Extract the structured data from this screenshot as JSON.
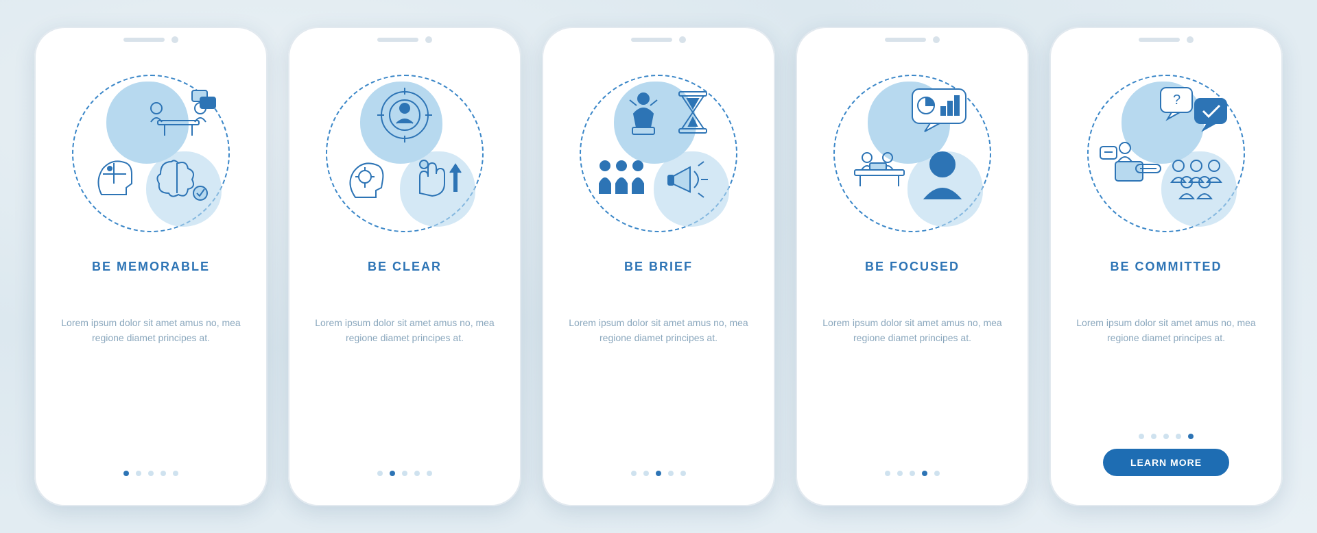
{
  "screens": [
    {
      "title": "BE MEMORABLE",
      "description": "Lorem ipsum dolor sit amet amus no, mea regione diamet principes at.",
      "icon": "memorable-icon",
      "activeDot": 0
    },
    {
      "title": "BE CLEAR",
      "description": "Lorem ipsum dolor sit amet amus no, mea regione diamet principes at.",
      "icon": "clear-icon",
      "activeDot": 1
    },
    {
      "title": "BE BRIEF",
      "description": "Lorem ipsum dolor sit amet amus no, mea regione diamet principes at.",
      "icon": "brief-icon",
      "activeDot": 2
    },
    {
      "title": "BE FOCUSED",
      "description": "Lorem ipsum dolor sit amet amus no, mea regione diamet principes at.",
      "icon": "focused-icon",
      "activeDot": 3
    },
    {
      "title": "BE COMMITTED",
      "description": "Lorem ipsum dolor sit amet amus no, mea regione diamet principes at.",
      "icon": "committed-icon",
      "activeDot": 4,
      "cta": "LEARN MORE"
    }
  ],
  "dotCount": 5,
  "colors": {
    "primary": "#2d74b5",
    "accentLight": "#b7d9ef",
    "textMuted": "#8aa7bd",
    "background": "#e8f0f5"
  }
}
